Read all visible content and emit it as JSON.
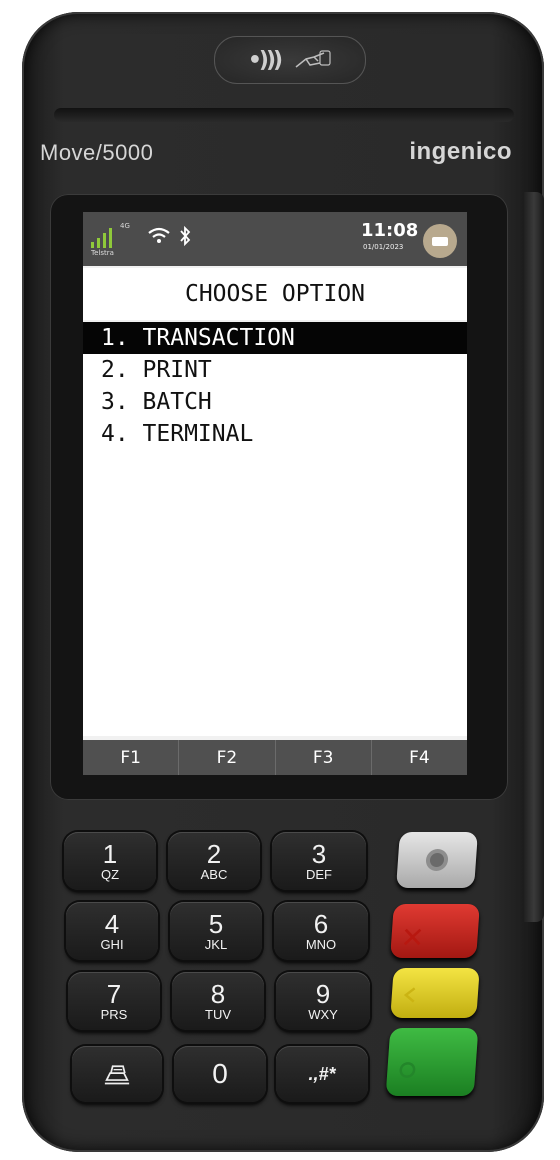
{
  "device": {
    "model": "Move/5000",
    "brand": "ingenico",
    "icons": [
      "contactless-icon",
      "tap-hand-icon"
    ]
  },
  "status_bar": {
    "network_type": "4G",
    "carrier": "Telstra",
    "time": "11:08",
    "date": "01/01/2023",
    "icons": [
      "signal-icon",
      "wifi-icon",
      "bluetooth-icon",
      "battery-icon"
    ]
  },
  "screen": {
    "title": "CHOOSE OPTION",
    "menu_items": [
      {
        "label": "1. TRANSACTION",
        "selected": true
      },
      {
        "label": "2. PRINT",
        "selected": false
      },
      {
        "label": "3. BATCH",
        "selected": false
      },
      {
        "label": "4. TERMINAL",
        "selected": false
      }
    ],
    "function_keys": [
      "F1",
      "F2",
      "F3",
      "F4"
    ]
  },
  "keypad": {
    "keys": [
      {
        "num": "1",
        "letters": "QZ"
      },
      {
        "num": "2",
        "letters": "ABC"
      },
      {
        "num": "3",
        "letters": "DEF"
      },
      {
        "num": "4",
        "letters": "GHI"
      },
      {
        "num": "5",
        "letters": "JKL"
      },
      {
        "num": "6",
        "letters": "MNO"
      },
      {
        "num": "7",
        "letters": "PRS"
      },
      {
        "num": "8",
        "letters": "TUV"
      },
      {
        "num": "9",
        "letters": "WXY"
      }
    ],
    "zero": "0",
    "symbols": ".,#*",
    "feed_icon": "paper-feed-icon"
  },
  "control_keys": {
    "colors": {
      "menu": "#cfcfcf",
      "cancel": "#d0251d",
      "correct": "#e6d22a",
      "enter": "#2fa334"
    },
    "icons": [
      "menu-key-icon",
      "cancel-icon",
      "correct-icon",
      "enter-icon"
    ]
  }
}
